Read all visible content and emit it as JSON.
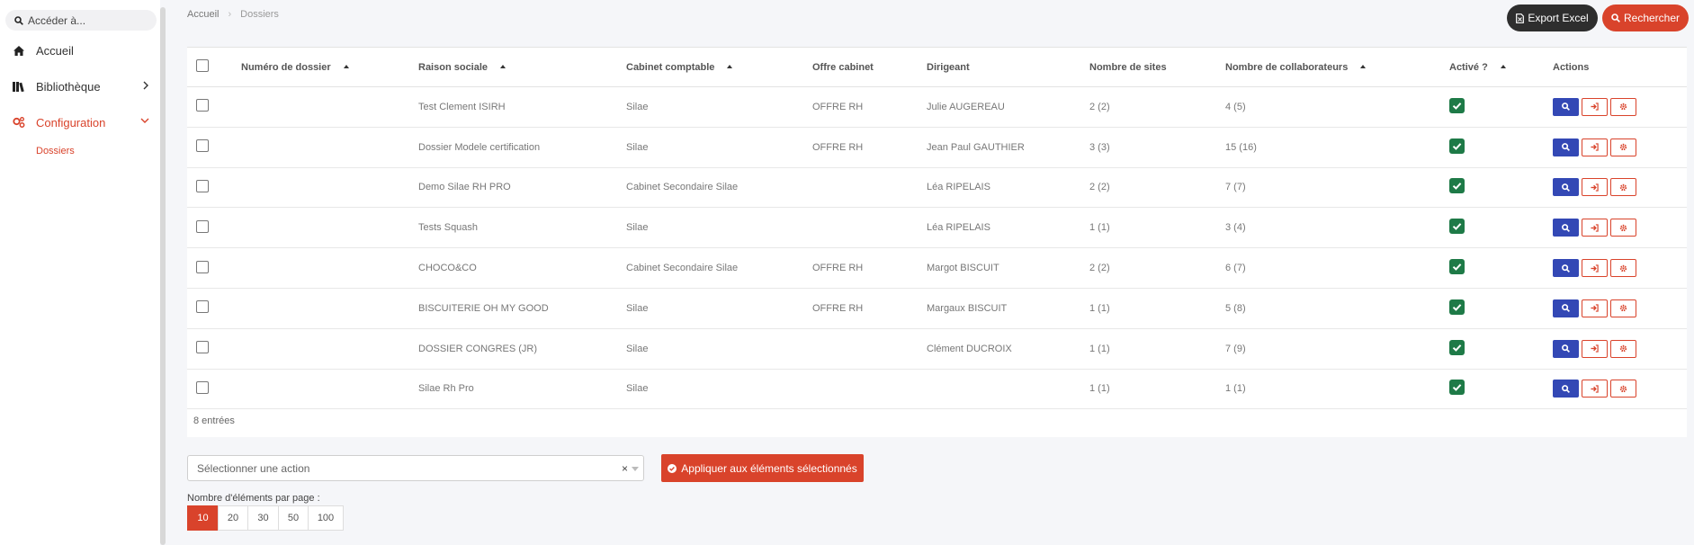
{
  "sidebar": {
    "search_placeholder": "Accéder à...",
    "items": [
      {
        "label": "Accueil",
        "icon": "home-icon"
      },
      {
        "label": "Bibliothèque",
        "icon": "books-icon"
      },
      {
        "label": "Configuration",
        "icon": "gears-icon"
      }
    ],
    "sub_item": "Dossiers"
  },
  "breadcrumb": {
    "home": "Accueil",
    "current": "Dossiers"
  },
  "toolbar": {
    "export_label": "Export Excel",
    "search_label": "Rechercher"
  },
  "table": {
    "headers": [
      "Numéro de dossier",
      "Raison sociale",
      "Cabinet comptable",
      "Offre cabinet",
      "Dirigeant",
      "Nombre de sites",
      "Nombre de collaborateurs",
      "Activé ?",
      "Actions"
    ],
    "rows": [
      {
        "numero": "",
        "raison": "Test Clement ISIRH",
        "cabinet": "Silae",
        "offre": "OFFRE RH",
        "dirigeant": "Julie AUGEREAU",
        "sites": "2 (2)",
        "collab": "4 (5)"
      },
      {
        "numero": "",
        "raison": "Dossier Modele certification",
        "cabinet": "Silae",
        "offre": "OFFRE RH",
        "dirigeant": "Jean Paul GAUTHIER",
        "sites": "3 (3)",
        "collab": "15 (16)"
      },
      {
        "numero": "",
        "raison": "Demo Silae RH PRO",
        "cabinet": "Cabinet Secondaire Silae",
        "offre": "",
        "dirigeant": "Léa RIPELAIS",
        "sites": "2 (2)",
        "collab": "7 (7)"
      },
      {
        "numero": "",
        "raison": "Tests Squash",
        "cabinet": "Silae",
        "offre": "",
        "dirigeant": "Léa RIPELAIS",
        "sites": "1 (1)",
        "collab": "3 (4)"
      },
      {
        "numero": "",
        "raison": "CHOCO&CO",
        "cabinet": "Cabinet Secondaire Silae",
        "offre": "OFFRE RH",
        "dirigeant": "Margot BISCUIT",
        "sites": "2 (2)",
        "collab": "6 (7)"
      },
      {
        "numero": "",
        "raison": "BISCUITERIE OH MY GOOD",
        "cabinet": "Silae",
        "offre": "OFFRE RH",
        "dirigeant": "Margaux BISCUIT",
        "sites": "1 (1)",
        "collab": "5 (8)"
      },
      {
        "numero": "",
        "raison": "DOSSIER CONGRES (JR)",
        "cabinet": "Silae",
        "offre": "",
        "dirigeant": "Clément DUCROIX",
        "sites": "1 (1)",
        "collab": "7 (9)"
      },
      {
        "numero": "",
        "raison": "Silae Rh Pro",
        "cabinet": "Silae",
        "offre": "",
        "dirigeant": "",
        "sites": "1 (1)",
        "collab": "1 (1)"
      }
    ],
    "entries_label": "8 entrées"
  },
  "bulk": {
    "select_placeholder": "Sélectionner une action",
    "clear": "×",
    "apply_label": "Appliquer aux éléments sélectionnés"
  },
  "pagination": {
    "label": "Nombre d'éléments par page :",
    "options": [
      "10",
      "20",
      "30",
      "50",
      "100"
    ],
    "selected": "10"
  },
  "colors": {
    "accent": "#d9432b",
    "dark": "#2e2e2e",
    "blue": "#3348b5",
    "green": "#1e7a47"
  }
}
